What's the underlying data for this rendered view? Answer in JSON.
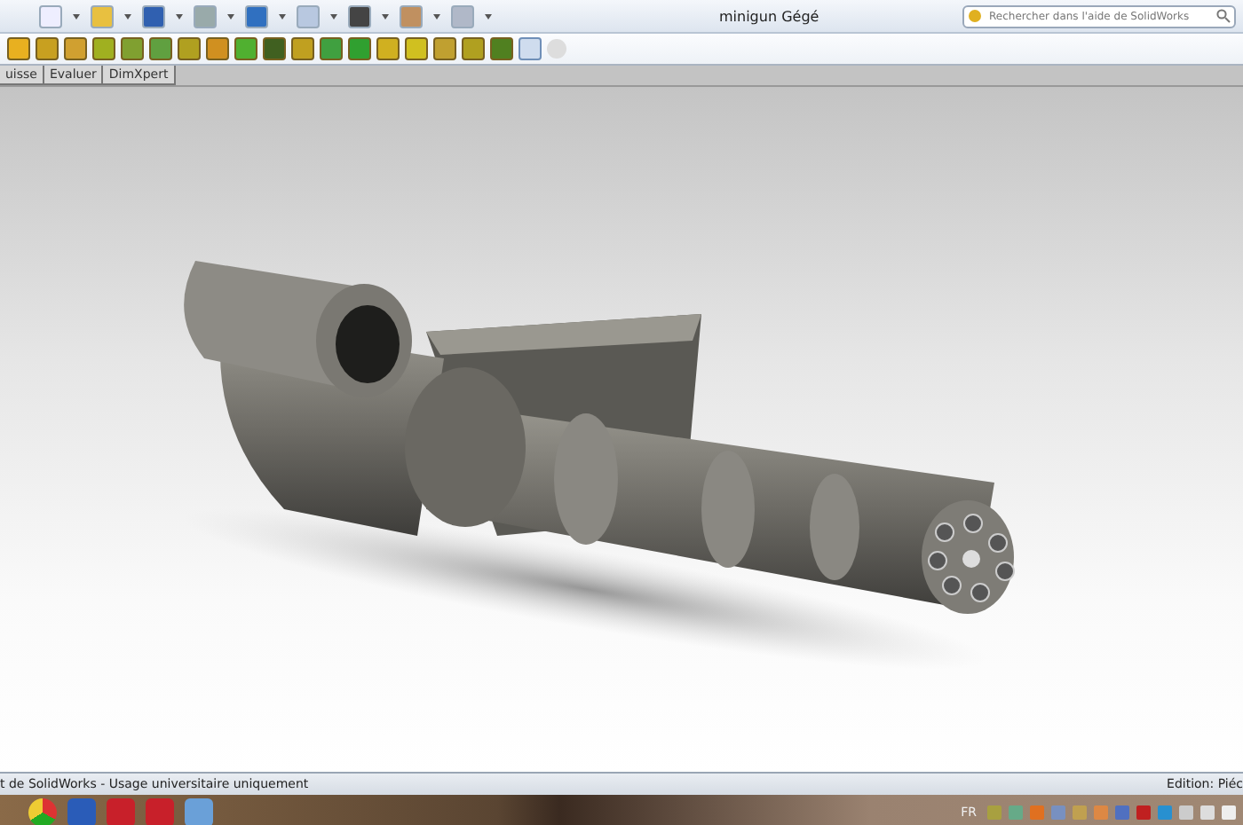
{
  "window": {
    "title": "minigun Gégé"
  },
  "search": {
    "placeholder": "Rechercher dans l'aide de SolidWorks"
  },
  "tabs": [
    {
      "label": "uisse",
      "selected": false
    },
    {
      "label": "Evaluer",
      "selected": false
    },
    {
      "label": "DimXpert",
      "selected": false
    }
  ],
  "status_bar": {
    "left": "t de SolidWorks - Usage universitaire uniquement",
    "right": "Edition: Piéc"
  },
  "taskbar": {
    "language": "FR"
  }
}
